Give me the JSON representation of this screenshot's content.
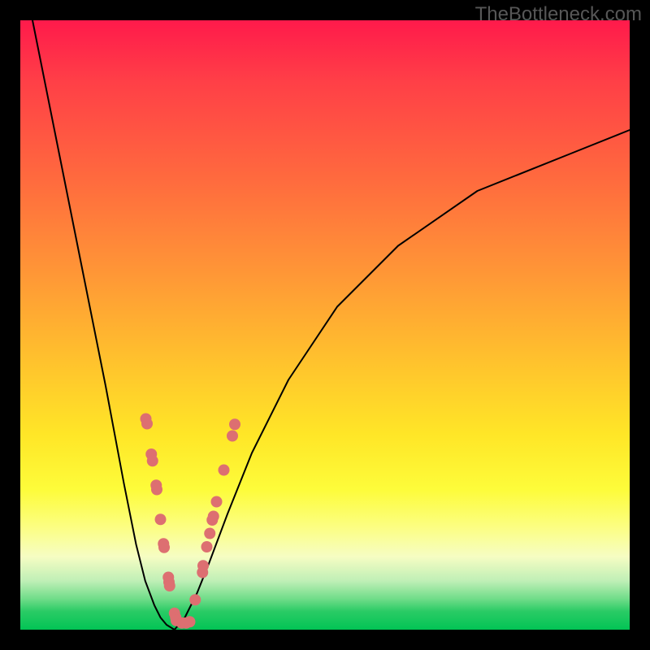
{
  "watermark": "TheBottleneck.com",
  "chart_data": {
    "type": "line",
    "title": "",
    "xlabel": "",
    "ylabel": "",
    "xlim": [
      0,
      100
    ],
    "ylim": [
      0,
      100
    ],
    "grid": false,
    "legend": false,
    "series": [
      {
        "name": "left-branch",
        "x": [
          2,
          6,
          10,
          14,
          17,
          19,
          20.5,
          22,
          23,
          24,
          25.3
        ],
        "y": [
          100,
          80,
          60,
          40,
          24,
          14,
          8,
          4,
          2,
          0.8,
          0
        ],
        "stroke": "#000000",
        "stroke_width": 2
      },
      {
        "name": "right-branch",
        "x": [
          25.3,
          27,
          29,
          31,
          34,
          38,
          44,
          52,
          62,
          75,
          90,
          100
        ],
        "y": [
          0,
          2,
          6,
          11,
          19,
          29,
          41,
          53,
          63,
          72,
          78,
          82
        ],
        "stroke": "#000000",
        "stroke_width": 2
      }
    ],
    "markers": {
      "name": "highlighted-points",
      "comment": "Pink dots clustered around the minimum of the V-curve",
      "color": "#dd6f71",
      "points": [
        {
          "x": 20.6,
          "y": 34.6
        },
        {
          "x": 20.8,
          "y": 33.8
        },
        {
          "x": 21.5,
          "y": 28.8
        },
        {
          "x": 21.7,
          "y": 27.7
        },
        {
          "x": 22.3,
          "y": 23.7
        },
        {
          "x": 22.4,
          "y": 23.0
        },
        {
          "x": 23.0,
          "y": 18.1
        },
        {
          "x": 23.5,
          "y": 14.1
        },
        {
          "x": 23.6,
          "y": 13.5
        },
        {
          "x": 24.3,
          "y": 8.6
        },
        {
          "x": 24.4,
          "y": 7.8
        },
        {
          "x": 24.5,
          "y": 7.2
        },
        {
          "x": 25.3,
          "y": 2.7
        },
        {
          "x": 25.5,
          "y": 2.0
        },
        {
          "x": 25.6,
          "y": 1.5
        },
        {
          "x": 26.5,
          "y": 1.1
        },
        {
          "x": 27.2,
          "y": 1.1
        },
        {
          "x": 27.8,
          "y": 1.3
        },
        {
          "x": 28.7,
          "y": 4.9
        },
        {
          "x": 29.9,
          "y": 9.4
        },
        {
          "x": 30.0,
          "y": 10.5
        },
        {
          "x": 30.6,
          "y": 13.6
        },
        {
          "x": 31.1,
          "y": 15.8
        },
        {
          "x": 31.5,
          "y": 18.0
        },
        {
          "x": 31.7,
          "y": 18.6
        },
        {
          "x": 32.2,
          "y": 21.0
        },
        {
          "x": 33.4,
          "y": 26.2
        },
        {
          "x": 34.8,
          "y": 31.8
        },
        {
          "x": 35.2,
          "y": 33.7
        }
      ],
      "radius_px": 7
    },
    "gradient_stops": [
      {
        "pos": 0.0,
        "color": "#ff1a4b"
      },
      {
        "pos": 0.1,
        "color": "#ff3f47"
      },
      {
        "pos": 0.26,
        "color": "#ff6a3e"
      },
      {
        "pos": 0.42,
        "color": "#ff9836"
      },
      {
        "pos": 0.56,
        "color": "#ffc22d"
      },
      {
        "pos": 0.68,
        "color": "#ffe627"
      },
      {
        "pos": 0.77,
        "color": "#fdfc3a"
      },
      {
        "pos": 0.83,
        "color": "#fcfe80"
      },
      {
        "pos": 0.88,
        "color": "#f6fdc3"
      },
      {
        "pos": 0.92,
        "color": "#bfefb6"
      },
      {
        "pos": 0.95,
        "color": "#6edc88"
      },
      {
        "pos": 0.97,
        "color": "#2acb65"
      },
      {
        "pos": 1.0,
        "color": "#02c455"
      }
    ]
  }
}
